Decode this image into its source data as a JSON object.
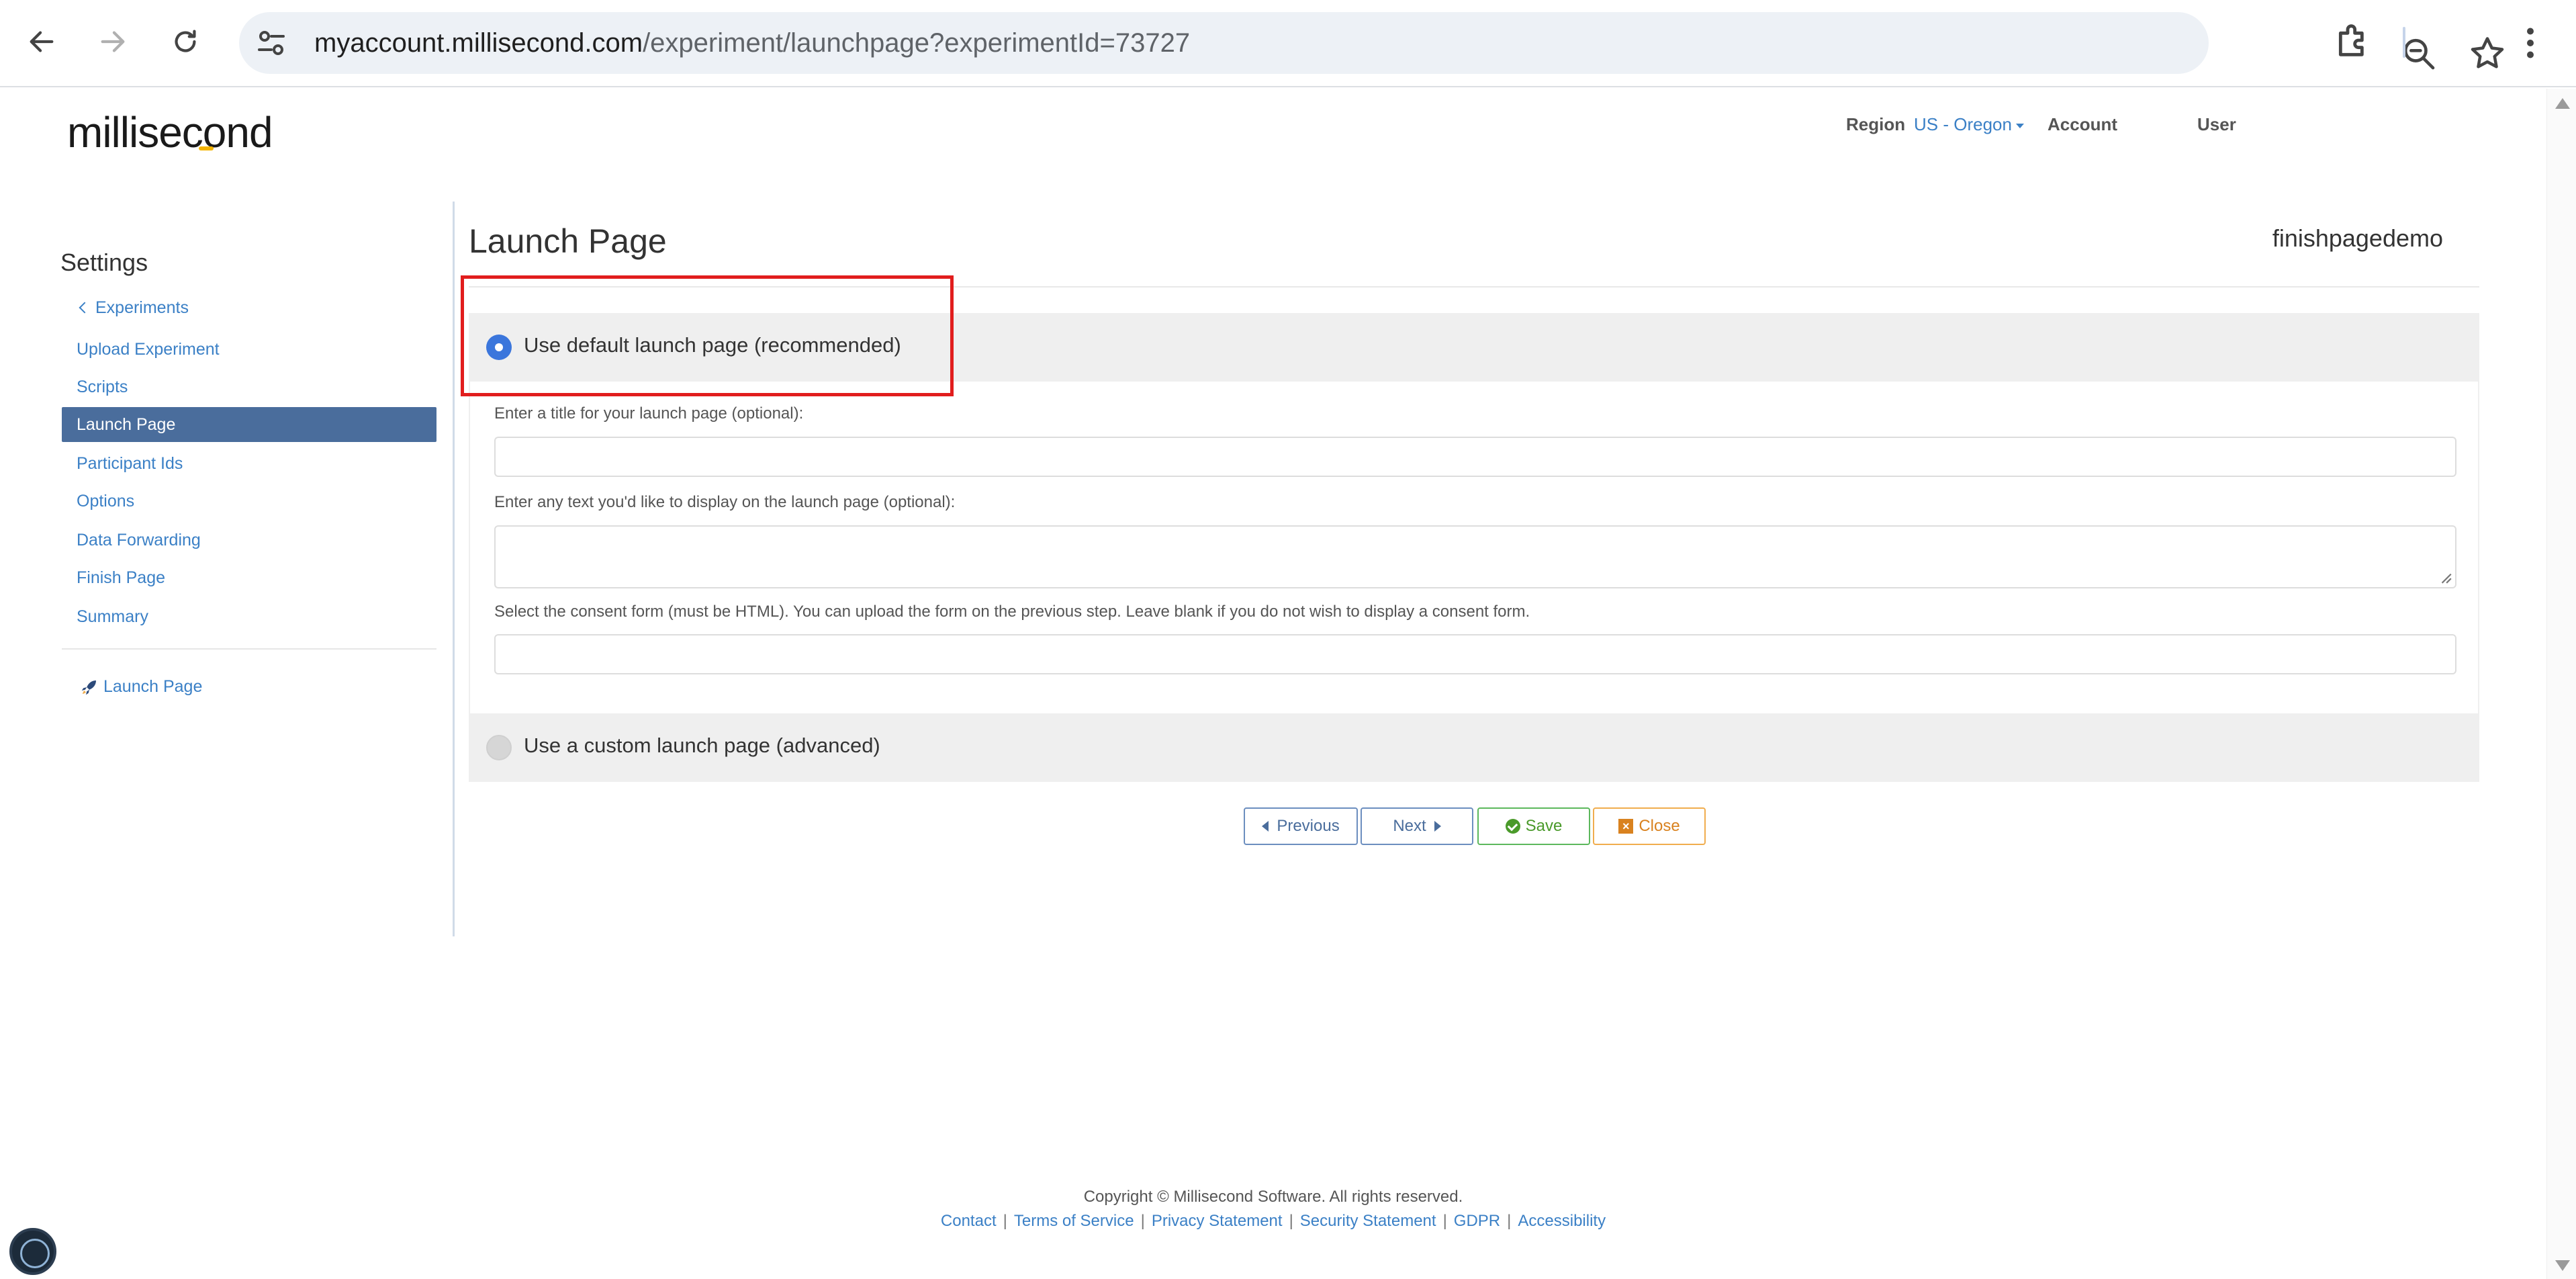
{
  "browser": {
    "url_host": "myaccount.millisecond.com",
    "url_path": "/experiment/launchpage?experimentId=73727"
  },
  "header": {
    "logo": "millisecond",
    "region_label": "Region",
    "region_value": "US - Oregon",
    "account": "Account",
    "user": "User"
  },
  "sidebar": {
    "title": "Settings",
    "back": "Experiments",
    "items": [
      {
        "label": "Upload Experiment"
      },
      {
        "label": "Scripts"
      },
      {
        "label": "Launch Page"
      },
      {
        "label": "Participant Ids"
      },
      {
        "label": "Options"
      },
      {
        "label": "Data Forwarding"
      },
      {
        "label": "Finish Page"
      },
      {
        "label": "Summary"
      }
    ],
    "launch_link": "Launch Page"
  },
  "main": {
    "title": "Launch Page",
    "experiment_name": "finishpagedemo",
    "option_default": "Use default launch page (recommended)",
    "title_field_label": "Enter a title for your launch page (optional):",
    "text_field_label": "Enter any text you'd like to display on the launch page (optional):",
    "consent_field_label": "Select the consent form (must be HTML). You can upload the form on the previous step. Leave blank if you do not wish to display a consent form.",
    "option_custom": "Use a custom launch page (advanced)"
  },
  "buttons": {
    "previous": "Previous",
    "next": "Next",
    "save": "Save",
    "close": "Close"
  },
  "footer": {
    "copyright": "Copyright © Millisecond Software. All rights reserved.",
    "links": {
      "contact": "Contact",
      "terms": "Terms of Service",
      "privacy": "Privacy Statement",
      "security": "Security Statement",
      "gdpr": "GDPR",
      "accessibility": "Accessibility"
    }
  },
  "colors": {
    "accent": "#3b80c6",
    "sidebar_active": "#4a6d9c",
    "highlight": "#e11d1d",
    "save": "#5cb85c",
    "close": "#f0ad4e"
  }
}
